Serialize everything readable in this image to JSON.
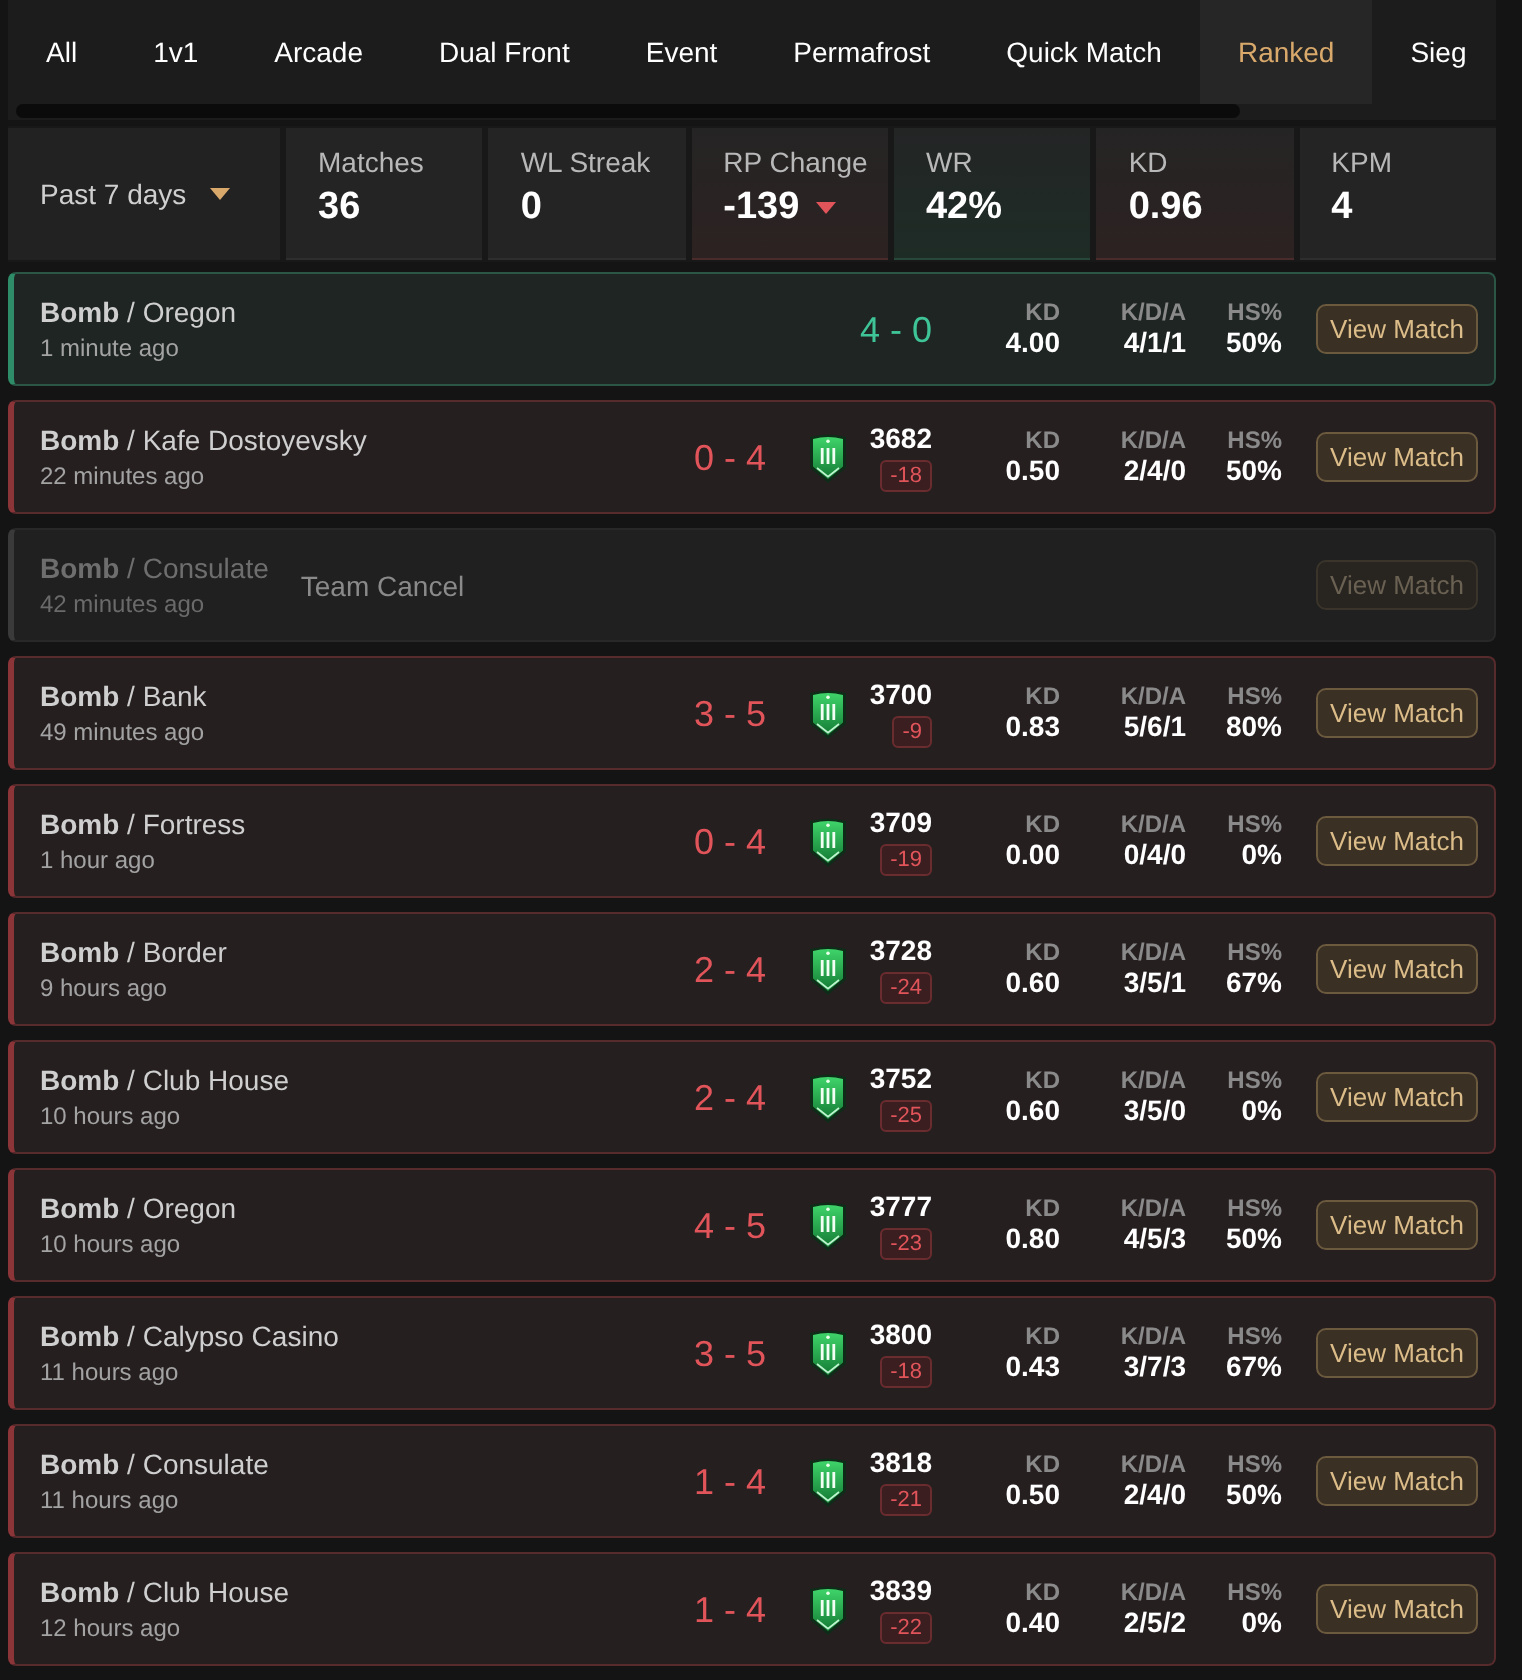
{
  "tabs": [
    {
      "label": "All",
      "selected": false
    },
    {
      "label": "1v1",
      "selected": false
    },
    {
      "label": "Arcade",
      "selected": false
    },
    {
      "label": "Dual Front",
      "selected": false
    },
    {
      "label": "Event",
      "selected": false
    },
    {
      "label": "Permafrost",
      "selected": false
    },
    {
      "label": "Quick Match",
      "selected": false
    },
    {
      "label": "Ranked",
      "selected": true
    },
    {
      "label": "Sieg",
      "selected": false
    }
  ],
  "period_select": {
    "value": "Past 7 days"
  },
  "summary": [
    {
      "label": "Matches",
      "value": "36",
      "kind": "neutral",
      "trend_down": false
    },
    {
      "label": "WL Streak",
      "value": "0",
      "kind": "neutral",
      "trend_down": false
    },
    {
      "label": "RP Change",
      "value": "-139",
      "kind": "loss",
      "trend_down": true
    },
    {
      "label": "WR",
      "value": "42%",
      "kind": "win",
      "trend_down": false
    },
    {
      "label": "KD",
      "value": "0.96",
      "kind": "loss",
      "trend_down": false
    },
    {
      "label": "KPM",
      "value": "4",
      "kind": "neutral",
      "trend_down": false
    }
  ],
  "matches": [
    {
      "kind": "win",
      "title": "**Bomb** / Oregon",
      "time": "1 minute ago",
      "score": "4 - 0",
      "stats": [
        {
          "label": "KD",
          "value": "4.00"
        },
        {
          "label": "K/D/A",
          "value": "4/1/1"
        },
        {
          "label": "HS%",
          "value": "50%"
        }
      ],
      "button": {
        "label": "View Match",
        "disabled": false
      }
    },
    {
      "kind": "loss",
      "title": "**Bomb** / Kafe Dostoyevsky",
      "time": "22 minutes ago",
      "score": "0 - 4",
      "rank": {
        "points": "3682",
        "change": "-18"
      },
      "stats": [
        {
          "label": "KD",
          "value": "0.50"
        },
        {
          "label": "K/D/A",
          "value": "2/4/0"
        },
        {
          "label": "HS%",
          "value": "50%"
        }
      ],
      "button": {
        "label": "View Match",
        "disabled": false
      }
    },
    {
      "kind": "cancelled",
      "title": "**Bomb** / Consulate",
      "time": "42 minutes ago",
      "note": "Team Cancel",
      "button": {
        "label": "View Match",
        "disabled": true
      }
    },
    {
      "kind": "loss",
      "title": "**Bomb** / Bank",
      "time": "49 minutes ago",
      "score": "3 - 5",
      "rank": {
        "points": "3700",
        "change": "-9"
      },
      "stats": [
        {
          "label": "KD",
          "value": "0.83"
        },
        {
          "label": "K/D/A",
          "value": "5/6/1"
        },
        {
          "label": "HS%",
          "value": "80%"
        }
      ],
      "button": {
        "label": "View Match",
        "disabled": false
      }
    },
    {
      "kind": "loss",
      "title": "**Bomb** / Fortress",
      "time": "1 hour ago",
      "score": "0 - 4",
      "rank": {
        "points": "3709",
        "change": "-19"
      },
      "stats": [
        {
          "label": "KD",
          "value": "0.00"
        },
        {
          "label": "K/D/A",
          "value": "0/4/0"
        },
        {
          "label": "HS%",
          "value": "0%"
        }
      ],
      "button": {
        "label": "View Match",
        "disabled": false
      }
    },
    {
      "kind": "loss",
      "title": "**Bomb** / Border",
      "time": "9 hours ago",
      "score": "2 - 4",
      "rank": {
        "points": "3728",
        "change": "-24"
      },
      "stats": [
        {
          "label": "KD",
          "value": "0.60"
        },
        {
          "label": "K/D/A",
          "value": "3/5/1"
        },
        {
          "label": "HS%",
          "value": "67%"
        }
      ],
      "button": {
        "label": "View Match",
        "disabled": false
      }
    },
    {
      "kind": "loss",
      "title": "**Bomb** / Club House",
      "time": "10 hours ago",
      "score": "2 - 4",
      "rank": {
        "points": "3752",
        "change": "-25"
      },
      "stats": [
        {
          "label": "KD",
          "value": "0.60"
        },
        {
          "label": "K/D/A",
          "value": "3/5/0"
        },
        {
          "label": "HS%",
          "value": "0%"
        }
      ],
      "button": {
        "label": "View Match",
        "disabled": false
      }
    },
    {
      "kind": "loss",
      "title": "**Bomb** / Oregon",
      "time": "10 hours ago",
      "score": "4 - 5",
      "rank": {
        "points": "3777",
        "change": "-23"
      },
      "stats": [
        {
          "label": "KD",
          "value": "0.80"
        },
        {
          "label": "K/D/A",
          "value": "4/5/3"
        },
        {
          "label": "HS%",
          "value": "50%"
        }
      ],
      "button": {
        "label": "View Match",
        "disabled": false
      }
    },
    {
      "kind": "loss",
      "title": "**Bomb** / Calypso Casino",
      "time": "11 hours ago",
      "score": "3 - 5",
      "rank": {
        "points": "3800",
        "change": "-18"
      },
      "stats": [
        {
          "label": "KD",
          "value": "0.43"
        },
        {
          "label": "K/D/A",
          "value": "3/7/3"
        },
        {
          "label": "HS%",
          "value": "67%"
        }
      ],
      "button": {
        "label": "View Match",
        "disabled": false
      }
    },
    {
      "kind": "loss",
      "title": "**Bomb** / Consulate",
      "time": "11 hours ago",
      "score": "1 - 4",
      "rank": {
        "points": "3818",
        "change": "-21"
      },
      "stats": [
        {
          "label": "KD",
          "value": "0.50"
        },
        {
          "label": "K/D/A",
          "value": "2/4/0"
        },
        {
          "label": "HS%",
          "value": "50%"
        }
      ],
      "button": {
        "label": "View Match",
        "disabled": false
      }
    },
    {
      "kind": "loss",
      "title": "**Bomb** / Club House",
      "time": "12 hours ago",
      "score": "1 - 4",
      "rank": {
        "points": "3839",
        "change": "-22"
      },
      "stats": [
        {
          "label": "KD",
          "value": "0.40"
        },
        {
          "label": "K/D/A",
          "value": "2/5/2"
        },
        {
          "label": "HS%",
          "value": "0%"
        }
      ],
      "button": {
        "label": "View Match",
        "disabled": false
      }
    }
  ]
}
